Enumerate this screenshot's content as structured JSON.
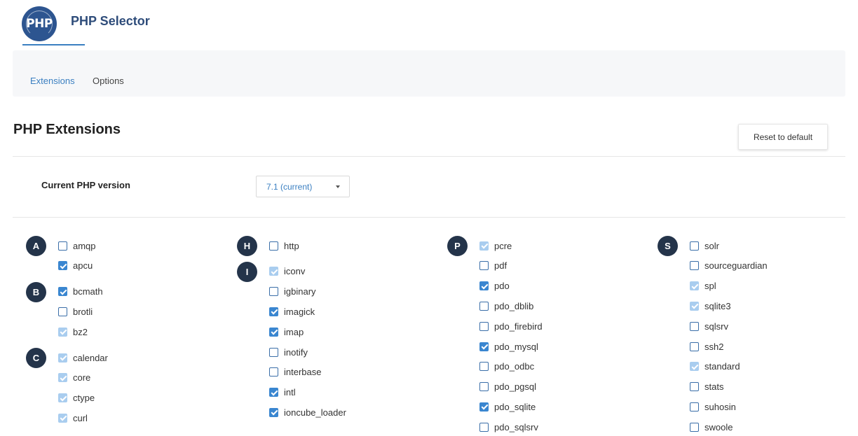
{
  "app": {
    "title": "PHP Selector",
    "logo_text": "PHP",
    "accent": "#3a7fc1",
    "brand": "#2d5590"
  },
  "tabs": [
    {
      "label": "Extensions",
      "active": true
    },
    {
      "label": "Options",
      "active": false
    }
  ],
  "section": {
    "title": "PHP Extensions",
    "reset_label": "Reset to default"
  },
  "version": {
    "label": "Current PHP version",
    "selected": "7.1 (current)"
  },
  "groups": [
    {
      "letter": "A",
      "items": [
        {
          "name": "amqp",
          "state": "unchecked"
        },
        {
          "name": "apcu",
          "state": "checked"
        }
      ]
    },
    {
      "letter": "B",
      "items": [
        {
          "name": "bcmath",
          "state": "checked"
        },
        {
          "name": "brotli",
          "state": "unchecked"
        },
        {
          "name": "bz2",
          "state": "disabled"
        }
      ]
    },
    {
      "letter": "C",
      "items": [
        {
          "name": "calendar",
          "state": "disabled"
        },
        {
          "name": "core",
          "state": "disabled"
        },
        {
          "name": "ctype",
          "state": "disabled"
        },
        {
          "name": "curl",
          "state": "disabled"
        }
      ]
    },
    {
      "letter": "H",
      "items": [
        {
          "name": "http",
          "state": "unchecked"
        }
      ]
    },
    {
      "letter": "I",
      "items": [
        {
          "name": "iconv",
          "state": "disabled"
        },
        {
          "name": "igbinary",
          "state": "unchecked"
        },
        {
          "name": "imagick",
          "state": "checked"
        },
        {
          "name": "imap",
          "state": "checked"
        },
        {
          "name": "inotify",
          "state": "unchecked"
        },
        {
          "name": "interbase",
          "state": "unchecked"
        },
        {
          "name": "intl",
          "state": "checked"
        },
        {
          "name": "ioncube_loader",
          "state": "checked"
        }
      ]
    },
    {
      "letter": "P",
      "items": [
        {
          "name": "pcre",
          "state": "disabled"
        },
        {
          "name": "pdf",
          "state": "unchecked"
        },
        {
          "name": "pdo",
          "state": "checked"
        },
        {
          "name": "pdo_dblib",
          "state": "unchecked"
        },
        {
          "name": "pdo_firebird",
          "state": "unchecked"
        },
        {
          "name": "pdo_mysql",
          "state": "checked"
        },
        {
          "name": "pdo_odbc",
          "state": "unchecked"
        },
        {
          "name": "pdo_pgsql",
          "state": "unchecked"
        },
        {
          "name": "pdo_sqlite",
          "state": "checked"
        },
        {
          "name": "pdo_sqlsrv",
          "state": "unchecked"
        }
      ]
    },
    {
      "letter": "S",
      "items": [
        {
          "name": "solr",
          "state": "unchecked"
        },
        {
          "name": "sourceguardian",
          "state": "unchecked"
        },
        {
          "name": "spl",
          "state": "disabled"
        },
        {
          "name": "sqlite3",
          "state": "disabled"
        },
        {
          "name": "sqlsrv",
          "state": "unchecked"
        },
        {
          "name": "ssh2",
          "state": "unchecked"
        },
        {
          "name": "standard",
          "state": "disabled"
        },
        {
          "name": "stats",
          "state": "unchecked"
        },
        {
          "name": "suhosin",
          "state": "unchecked"
        },
        {
          "name": "swoole",
          "state": "unchecked"
        }
      ]
    }
  ]
}
